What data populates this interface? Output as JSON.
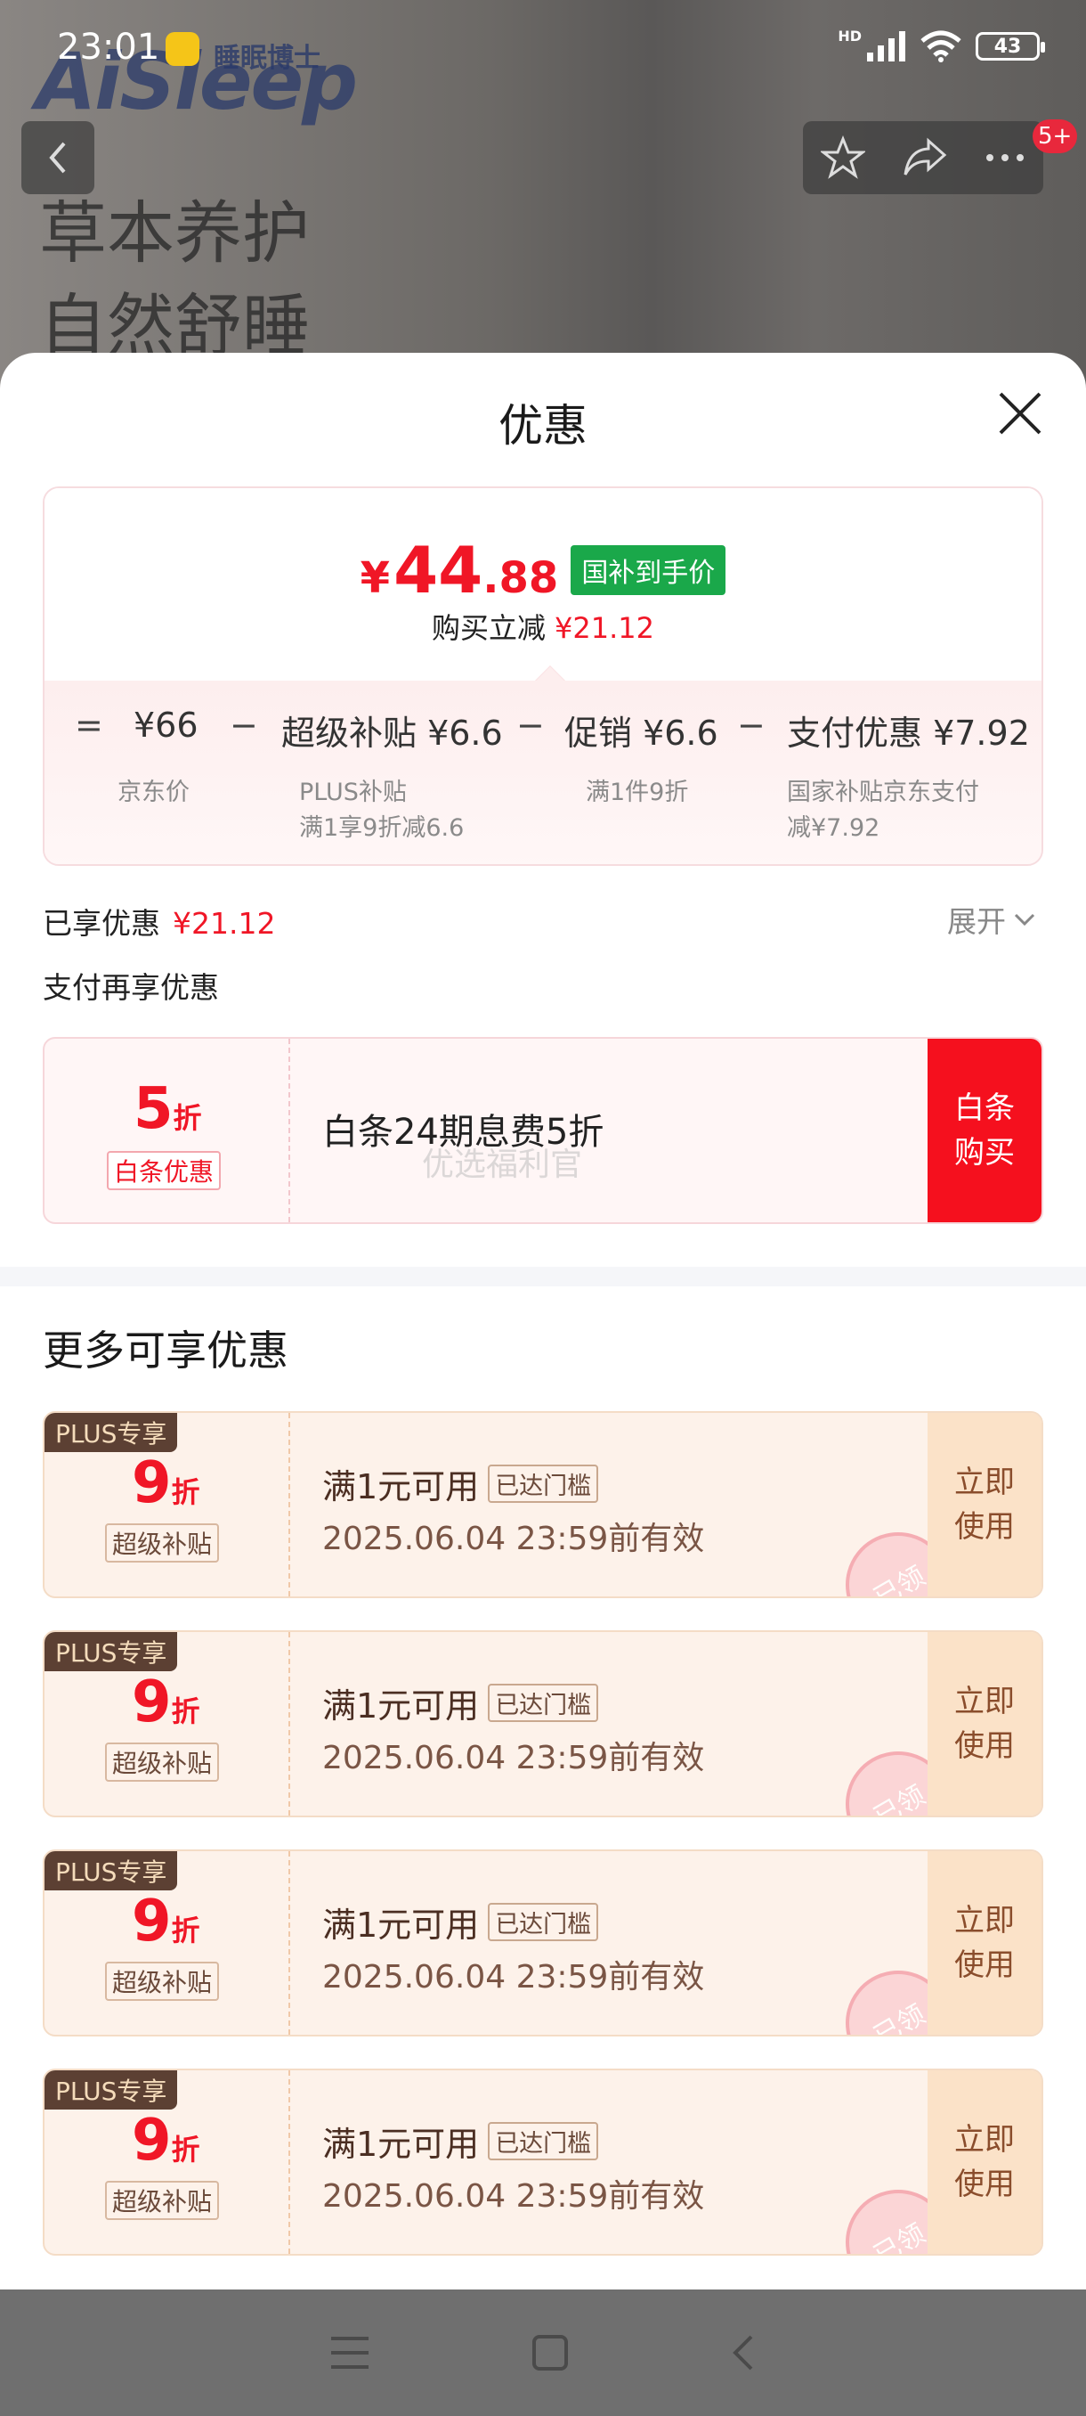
{
  "status_bar": {
    "time": "23:01",
    "network": "HD",
    "battery": "43"
  },
  "background": {
    "brand": "AiSleep",
    "brand_cn": "睡眠博士",
    "slogan_line1": "草本养护",
    "slogan_line2": "自然舒睡"
  },
  "nav": {
    "cart_badge": "5+"
  },
  "sheet": {
    "title": "优惠",
    "final_price": {
      "symbol": "¥",
      "integer": "44",
      "decimal": ".88",
      "tag": "国补到手价"
    },
    "instant_reduce": {
      "label": "购买立减",
      "value": "¥21.12"
    },
    "breakdown": {
      "eq": "=",
      "minus": "−",
      "items": [
        {
          "main": "¥66",
          "sub1": "京东价",
          "sub2": ""
        },
        {
          "main": "超级补贴 ¥6.6",
          "sub1": "PLUS补贴",
          "sub2": "满1享9折减6.6"
        },
        {
          "main": "促销 ¥6.6",
          "sub1": "满1件9折",
          "sub2": ""
        },
        {
          "main": "支付优惠 ¥7.92",
          "sub1": "国家补贴京东支付",
          "sub2": "减¥7.92"
        }
      ]
    },
    "enjoyed": {
      "label": "已享优惠",
      "value": "¥21.12",
      "expand": "展开"
    },
    "pay_again": "支付再享优惠",
    "baitiao": {
      "num": "5",
      "zhe": "折",
      "tag": "白条优惠",
      "desc": "白条24期息费5折",
      "watermark": "优选福利官",
      "button_line1": "白条",
      "button_line2": "购买"
    },
    "more_title": "更多可享优惠",
    "coupons": [
      {
        "plus": "PLUS专享",
        "num": "9",
        "zhe": "折",
        "tag": "超级补贴",
        "condition": "满1元可用",
        "reached": "已达门槛",
        "valid": "2025.06.04 23:59前有效",
        "button_line1": "立即",
        "button_line2": "使用",
        "stamp": "已领"
      },
      {
        "plus": "PLUS专享",
        "num": "9",
        "zhe": "折",
        "tag": "超级补贴",
        "condition": "满1元可用",
        "reached": "已达门槛",
        "valid": "2025.06.04 23:59前有效",
        "button_line1": "立即",
        "button_line2": "使用",
        "stamp": "已领"
      },
      {
        "plus": "PLUS专享",
        "num": "9",
        "zhe": "折",
        "tag": "超级补贴",
        "condition": "满1元可用",
        "reached": "已达门槛",
        "valid": "2025.06.04 23:59前有效",
        "button_line1": "立即",
        "button_line2": "使用",
        "stamp": "已领"
      },
      {
        "plus": "PLUS专享",
        "num": "9",
        "zhe": "折",
        "tag": "超级补贴",
        "condition": "满1元可用",
        "reached": "已达门槛",
        "valid": "2025.06.04 23:59前有效",
        "button_line1": "立即",
        "button_line2": "使用",
        "stamp": "已领"
      }
    ]
  },
  "colors": {
    "accent_red": "#f01626",
    "gov_green": "#1aa84a",
    "coupon_brown": "#5c4033"
  }
}
